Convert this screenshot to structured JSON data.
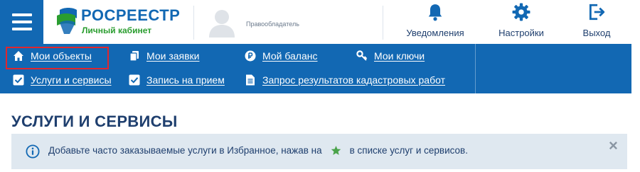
{
  "header": {
    "menu_icon": "hamburger-menu-icon",
    "logo": {
      "title": "РОСРЕЕСТР",
      "subtitle": "Личный кабинет",
      "colors": {
        "blue": "#1268b3",
        "green": "#2a9d2f"
      }
    },
    "user": {
      "avatar_icon": "user-silhouette-icon",
      "role": "Правообладатель"
    },
    "actions": [
      {
        "label": "Уведомления",
        "icon": "bell-icon"
      },
      {
        "label": "Настройки",
        "icon": "gear-icon"
      },
      {
        "label": "Выход",
        "icon": "exit-icon"
      }
    ]
  },
  "nav": {
    "background": "#1268b3",
    "row1": [
      {
        "label": "Мои объекты",
        "icon": "home-icon",
        "selected": true
      },
      {
        "label": "Мои заявки",
        "icon": "documents-icon"
      },
      {
        "label": "Мой баланс",
        "icon": "ruble-icon"
      },
      {
        "label": "Мои ключи",
        "icon": "key-icon"
      }
    ],
    "row2": [
      {
        "label": "Услуги и сервисы",
        "icon": "checkbox-icon"
      },
      {
        "label": "Запись на прием",
        "icon": "checkbox-icon"
      },
      {
        "label": "Запрос результатов кадастровых работ",
        "icon": "document-icon"
      }
    ],
    "highlight_color": "#e0262d"
  },
  "page": {
    "title": "УСЛУГИ И СЕРВИСЫ",
    "alert": {
      "icon": "info-icon",
      "text_before": "Добавьте часто заказываемые услуги в Избранное, нажав на",
      "star_icon": "star-icon",
      "star_color": "#4aa34a",
      "text_after": "в списке услуг и сервисов.",
      "close_label": "×"
    }
  }
}
